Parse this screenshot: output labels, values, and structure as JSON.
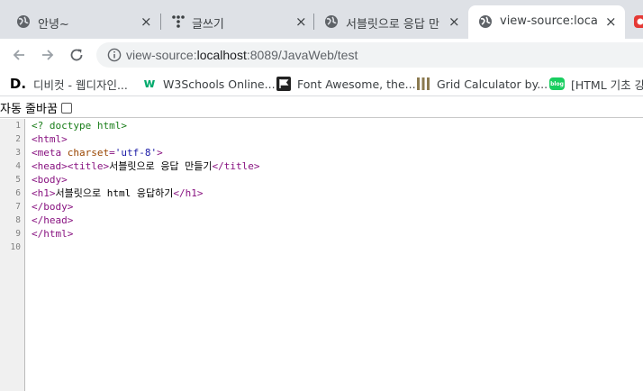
{
  "tabs": [
    {
      "title": "안녕~",
      "icon": "globe-icon",
      "active": false
    },
    {
      "title": "글쓰기",
      "icon": "dots-icon",
      "active": false
    },
    {
      "title": "서블릿으로 응답 만",
      "icon": "globe-icon",
      "active": false
    },
    {
      "title": "view-source:localho",
      "icon": "globe-icon",
      "active": true
    }
  ],
  "tab_close_glyph": "×",
  "url": {
    "scheme": "view-source:",
    "host": "localhost",
    "path": ":8089/JavaWeb/test"
  },
  "bookmarks": [
    {
      "label": "디비컷 - 웹디자인...",
      "icon_text": "D."
    },
    {
      "label": "W3Schools Online...",
      "icon_text": "w"
    },
    {
      "label": "Font Awesome, the...",
      "icon_text": ""
    },
    {
      "label": "Grid Calculator by...",
      "icon_text": ""
    },
    {
      "label": "[HTML 기초 강",
      "icon_text": "blog"
    }
  ],
  "line_wrap_label": "자동 줄바꿈",
  "line_numbers": [
    "1",
    "2",
    "3",
    "4",
    "5",
    "6",
    "7",
    "8",
    "9",
    "10"
  ],
  "source_lines": [
    {
      "parts": [
        {
          "cls": "doctype",
          "text": "<? doctype html>"
        }
      ]
    },
    {
      "parts": [
        {
          "cls": "tag",
          "text": "<html>"
        }
      ]
    },
    {
      "parts": [
        {
          "cls": "tag",
          "text": "<meta "
        },
        {
          "cls": "attr",
          "text": "charset"
        },
        {
          "cls": "tag",
          "text": "="
        },
        {
          "cls": "val",
          "text": "'utf-8'"
        },
        {
          "cls": "tag",
          "text": ">"
        }
      ]
    },
    {
      "parts": [
        {
          "cls": "tag",
          "text": "<head><title>"
        },
        {
          "cls": "",
          "text": "서블릿으로 응답 만들기"
        },
        {
          "cls": "tag",
          "text": "</title>"
        }
      ]
    },
    {
      "parts": [
        {
          "cls": "tag",
          "text": "<body>"
        }
      ]
    },
    {
      "parts": [
        {
          "cls": "tag",
          "text": "<h1>"
        },
        {
          "cls": "",
          "text": "서블릿으로 html 응답하기"
        },
        {
          "cls": "tag",
          "text": "</h1>"
        }
      ]
    },
    {
      "parts": [
        {
          "cls": "tag",
          "text": "</body>"
        }
      ]
    },
    {
      "parts": [
        {
          "cls": "tag",
          "text": "</head>"
        }
      ]
    },
    {
      "parts": [
        {
          "cls": "tag",
          "text": "</html>"
        }
      ]
    },
    {
      "parts": []
    }
  ],
  "colors": {
    "tab_strip": "#dee1e6",
    "omnibox": "#f1f3f4",
    "tag": "#881280",
    "attr": "#994500",
    "value": "#1a1aa6",
    "doctype": "#197d19"
  }
}
